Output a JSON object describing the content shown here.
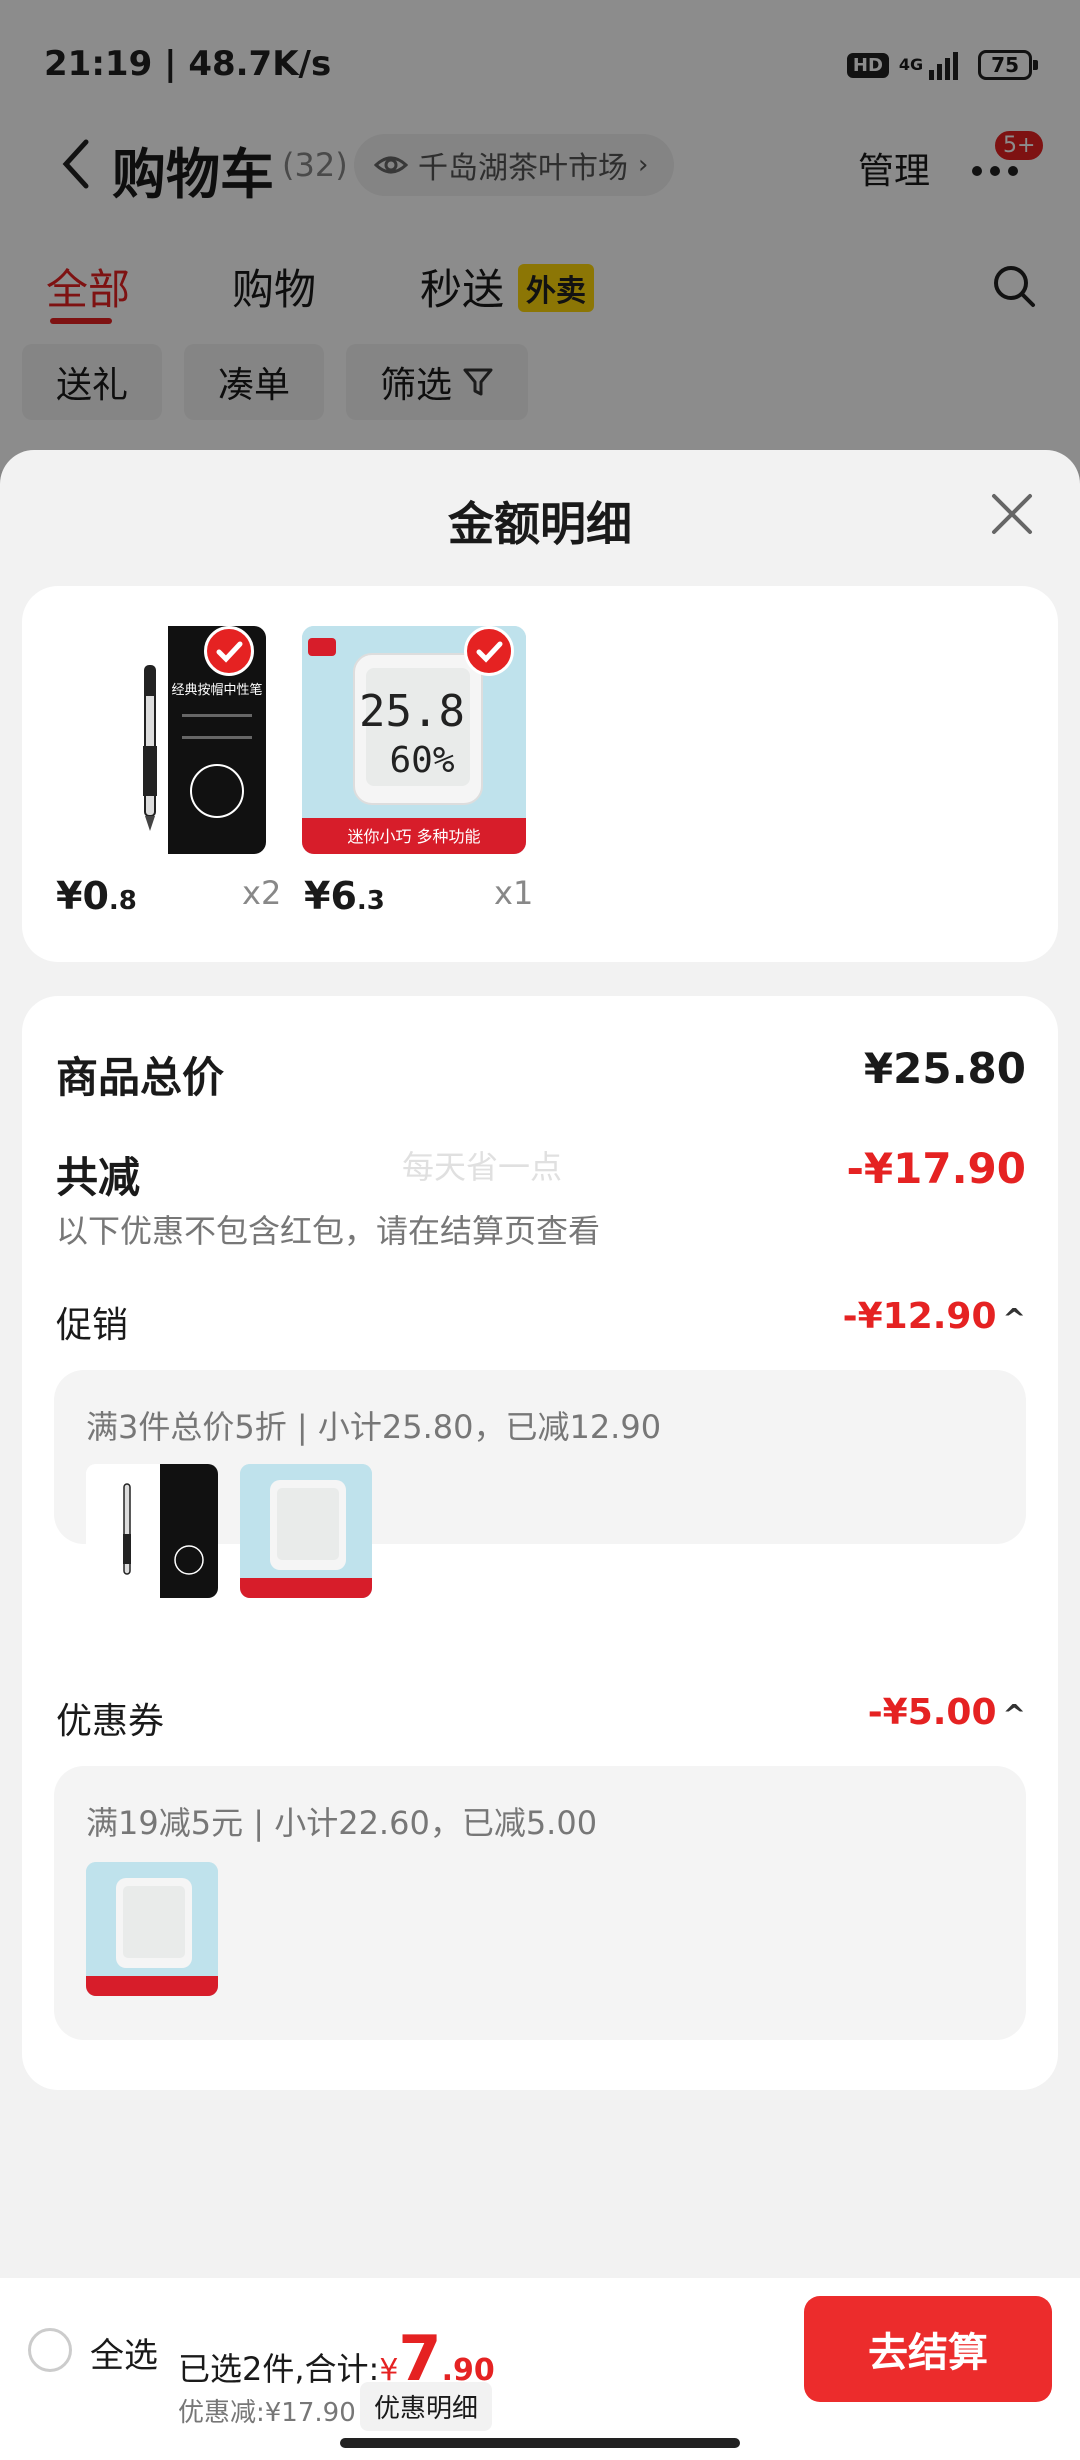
{
  "status_bar": {
    "time_speed": "21:19 | 48.7K/s",
    "hd": "HD",
    "network": "4G",
    "battery": "75"
  },
  "header": {
    "title": "购物车",
    "count": "(32)",
    "store": "千岛湖茶叶市场",
    "manage": "管理",
    "badge": "5+"
  },
  "tabs": [
    {
      "label": "全部",
      "active": true
    },
    {
      "label": "购物"
    },
    {
      "label": "秒送"
    }
  ],
  "tab_badge": "外卖",
  "chips": [
    {
      "label": "送礼"
    },
    {
      "label": "凑单"
    },
    {
      "label": "筛选"
    }
  ],
  "sheet": {
    "title": "金额明细",
    "products": [
      {
        "price_int": "¥0",
        "price_dec": ".8",
        "qty": "x2",
        "name": "pen-image",
        "pen_text": "经典按帽中性笔"
      },
      {
        "price_int": "¥6",
        "price_dec": ".3",
        "qty": "x1",
        "name": "thermometer-image",
        "temp": "25.8",
        "humidity": "60%",
        "banner": "迷你小巧 多种功能"
      }
    ],
    "total_label": "商品总价",
    "total_value": "¥25.80",
    "reduce_label": "共减",
    "reduce_value": "-¥17.90",
    "watermark": "每天省一点",
    "note": "以下优惠不包含红包，请在结算页查看",
    "promo": {
      "label": "促销",
      "value": "-¥12.90",
      "detail": "满3件总价5折 | 小计25.80，已减12.90"
    },
    "coupon": {
      "label": "优惠券",
      "value": "-¥5.00",
      "detail": "满19减5元 | 小计22.60，已减5.00"
    }
  },
  "bottom": {
    "select_all": "全选",
    "summary": "已选2件,合计:",
    "currency": "¥",
    "amount_int": "7",
    "amount_dec": ".90",
    "discount": "优惠减:¥17.90",
    "detail_button": "优惠明细",
    "checkout": "去结算"
  },
  "colors": {
    "accent": "#e52222",
    "checkout": "#ec2c2c"
  }
}
